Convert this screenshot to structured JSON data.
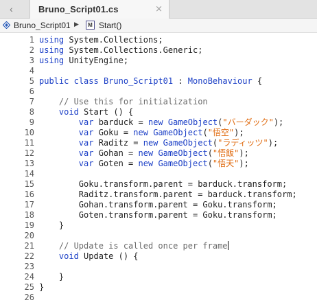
{
  "tab": {
    "title": "Bruno_Script01.cs",
    "close_glyph": "⨯",
    "back_glyph": "‹"
  },
  "breadcrumb": {
    "file": "Bruno_Script01",
    "separator": "▶",
    "member_icon": "M",
    "member": "Start()"
  },
  "colors": {
    "keyword": "#1b3fc6",
    "string": "#e06b10",
    "comment": "#6b6b6b"
  },
  "code_lines": [
    {
      "n": "1",
      "tokens": [
        {
          "t": "using",
          "c": "kw"
        },
        {
          "t": " System.Collections;",
          "c": ""
        }
      ]
    },
    {
      "n": "2",
      "tokens": [
        {
          "t": "using",
          "c": "kw"
        },
        {
          "t": " System.Collections.Generic;",
          "c": ""
        }
      ]
    },
    {
      "n": "3",
      "tokens": [
        {
          "t": "using",
          "c": "kw"
        },
        {
          "t": " UnityEngine;",
          "c": ""
        }
      ]
    },
    {
      "n": "4",
      "tokens": []
    },
    {
      "n": "5",
      "tokens": [
        {
          "t": "public",
          "c": "kw"
        },
        {
          "t": " ",
          "c": ""
        },
        {
          "t": "class",
          "c": "kw"
        },
        {
          "t": " ",
          "c": ""
        },
        {
          "t": "Bruno_Script01",
          "c": "type"
        },
        {
          "t": " : ",
          "c": ""
        },
        {
          "t": "MonoBehaviour",
          "c": "type"
        },
        {
          "t": " {",
          "c": ""
        }
      ]
    },
    {
      "n": "6",
      "tokens": []
    },
    {
      "n": "7",
      "tokens": [
        {
          "t": "    // Use this for initialization",
          "c": "cm"
        }
      ]
    },
    {
      "n": "8",
      "tokens": [
        {
          "t": "    ",
          "c": ""
        },
        {
          "t": "void",
          "c": "kw"
        },
        {
          "t": " Start () {",
          "c": ""
        }
      ]
    },
    {
      "n": "9",
      "tokens": [
        {
          "t": "        ",
          "c": ""
        },
        {
          "t": "var",
          "c": "kw"
        },
        {
          "t": " barduck = ",
          "c": ""
        },
        {
          "t": "new",
          "c": "kw"
        },
        {
          "t": " ",
          "c": ""
        },
        {
          "t": "GameObject",
          "c": "type"
        },
        {
          "t": "(",
          "c": ""
        },
        {
          "t": "\"バーダック\"",
          "c": "str"
        },
        {
          "t": ");",
          "c": ""
        }
      ]
    },
    {
      "n": "10",
      "tokens": [
        {
          "t": "        ",
          "c": ""
        },
        {
          "t": "var",
          "c": "kw"
        },
        {
          "t": " Goku = ",
          "c": ""
        },
        {
          "t": "new",
          "c": "kw"
        },
        {
          "t": " ",
          "c": ""
        },
        {
          "t": "GameObject",
          "c": "type"
        },
        {
          "t": "(",
          "c": ""
        },
        {
          "t": "\"悟空\"",
          "c": "str"
        },
        {
          "t": ");",
          "c": ""
        }
      ]
    },
    {
      "n": "11",
      "tokens": [
        {
          "t": "        ",
          "c": ""
        },
        {
          "t": "var",
          "c": "kw"
        },
        {
          "t": " Raditz = ",
          "c": ""
        },
        {
          "t": "new",
          "c": "kw"
        },
        {
          "t": " ",
          "c": ""
        },
        {
          "t": "GameObject",
          "c": "type"
        },
        {
          "t": "(",
          "c": ""
        },
        {
          "t": "\"ラディッツ\"",
          "c": "str"
        },
        {
          "t": ");",
          "c": ""
        }
      ]
    },
    {
      "n": "12",
      "tokens": [
        {
          "t": "        ",
          "c": ""
        },
        {
          "t": "var",
          "c": "kw"
        },
        {
          "t": " Gohan = ",
          "c": ""
        },
        {
          "t": "new",
          "c": "kw"
        },
        {
          "t": " ",
          "c": ""
        },
        {
          "t": "GameObject",
          "c": "type"
        },
        {
          "t": "(",
          "c": ""
        },
        {
          "t": "\"悟飯\"",
          "c": "str"
        },
        {
          "t": ");",
          "c": ""
        }
      ]
    },
    {
      "n": "13",
      "tokens": [
        {
          "t": "        ",
          "c": ""
        },
        {
          "t": "var",
          "c": "kw"
        },
        {
          "t": " Goten = ",
          "c": ""
        },
        {
          "t": "new",
          "c": "kw"
        },
        {
          "t": " ",
          "c": ""
        },
        {
          "t": "GameObject",
          "c": "type"
        },
        {
          "t": "(",
          "c": ""
        },
        {
          "t": "\"悟天\"",
          "c": "str"
        },
        {
          "t": ");",
          "c": ""
        }
      ]
    },
    {
      "n": "14",
      "tokens": []
    },
    {
      "n": "15",
      "tokens": [
        {
          "t": "        Goku.transform.parent = barduck.transform;",
          "c": ""
        }
      ]
    },
    {
      "n": "16",
      "tokens": [
        {
          "t": "        Raditz.transform.parent = barduck.transform;",
          "c": ""
        }
      ]
    },
    {
      "n": "17",
      "tokens": [
        {
          "t": "        Gohan.transform.parent = Goku.transform;",
          "c": ""
        }
      ]
    },
    {
      "n": "18",
      "tokens": [
        {
          "t": "        Goten.transform.parent = Goku.transform;",
          "c": ""
        }
      ]
    },
    {
      "n": "19",
      "tokens": [
        {
          "t": "    }",
          "c": ""
        }
      ]
    },
    {
      "n": "20",
      "tokens": []
    },
    {
      "n": "21",
      "tokens": [
        {
          "t": "    // Update is called once per frame",
          "c": "cm"
        }
      ],
      "cursor": true
    },
    {
      "n": "22",
      "tokens": [
        {
          "t": "    ",
          "c": ""
        },
        {
          "t": "void",
          "c": "kw"
        },
        {
          "t": " Update () {",
          "c": ""
        }
      ]
    },
    {
      "n": "23",
      "tokens": []
    },
    {
      "n": "24",
      "tokens": [
        {
          "t": "    }",
          "c": ""
        }
      ]
    },
    {
      "n": "25",
      "tokens": [
        {
          "t": "}",
          "c": ""
        }
      ]
    },
    {
      "n": "26",
      "tokens": []
    }
  ]
}
